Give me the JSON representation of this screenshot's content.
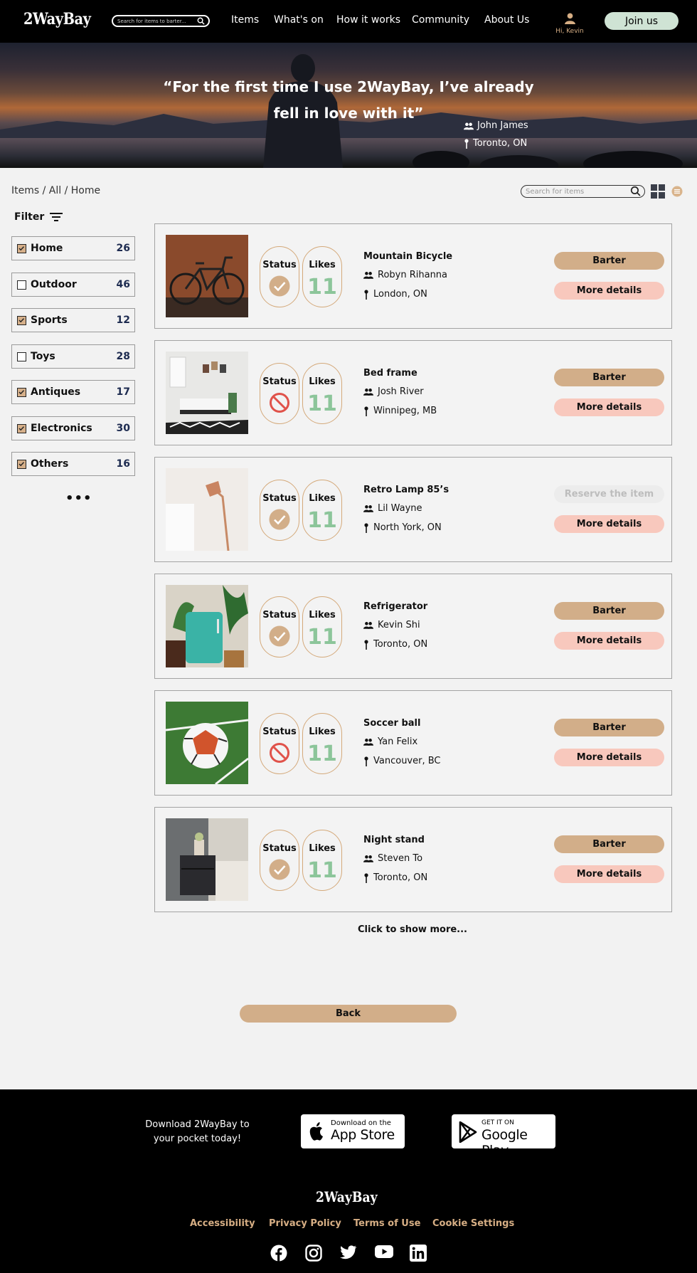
{
  "brand": {
    "logo": "2WayBay"
  },
  "header": {
    "search_placeholder": "Search for items to barter...",
    "nav": [
      "Items",
      "What's on",
      "How it works",
      "Community",
      "About Us"
    ],
    "user_label": "Hi, Kevin",
    "join_label": "Join us"
  },
  "hero": {
    "quote_line1": "“For the first time I use 2WayBay, I’ve already",
    "quote_line2": "fell in love with it”",
    "author": "John James",
    "location": "Toronto, ON"
  },
  "breadcrumb": {
    "items": "Items",
    "all": "All",
    "home": "Home",
    "sep": " / "
  },
  "tools": {
    "search_placeholder": "Search for items"
  },
  "filter": {
    "title": "Filter",
    "categories": [
      {
        "label": "Home",
        "count": "26",
        "checked": true
      },
      {
        "label": "Outdoor",
        "count": "46",
        "checked": false
      },
      {
        "label": "Sports",
        "count": "12",
        "checked": true
      },
      {
        "label": "Toys",
        "count": "28",
        "checked": false
      },
      {
        "label": "Antiques",
        "count": "17",
        "checked": true
      },
      {
        "label": "Electronics",
        "count": "30",
        "checked": true
      },
      {
        "label": "Others",
        "count": "16",
        "checked": true
      }
    ],
    "more": "•••"
  },
  "listing": {
    "status_label": "Status",
    "likes_label": "Likes",
    "barter_label": "Barter",
    "reserve_label": "Reserve the item",
    "details_label": "More details",
    "items": [
      {
        "name": "Mountain Bicycle",
        "owner": "Robyn Rihanna",
        "location": "London, ON",
        "likes": "11",
        "status": "available",
        "action": "barter",
        "photo": "bicycle"
      },
      {
        "name": "Bed frame",
        "owner": "Josh River",
        "location": "Winnipeg, MB",
        "likes": "11",
        "status": "unavailable",
        "action": "barter",
        "photo": "bedroom"
      },
      {
        "name": "Retro Lamp 85’s",
        "owner": "Lil Wayne",
        "location": "North York, ON",
        "likes": "11",
        "status": "available",
        "action": "reserve",
        "photo": "lamp"
      },
      {
        "name": "Refrigerator",
        "owner": "Kevin Shi",
        "location": "Toronto, ON",
        "likes": "11",
        "status": "available",
        "action": "barter",
        "photo": "refrigerator"
      },
      {
        "name": "Soccer ball",
        "owner": "Yan Felix",
        "location": "Vancouver, BC",
        "likes": "11",
        "status": "unavailable",
        "action": "barter",
        "photo": "soccer-ball"
      },
      {
        "name": "Night stand",
        "owner": "Steven To",
        "location": "Toronto, ON",
        "likes": "11",
        "status": "available",
        "action": "barter",
        "photo": "night-stand"
      }
    ],
    "show_more": "Click to show more...",
    "back_label": "Back"
  },
  "footer": {
    "download_text": "Download 2WayBay to your pocket today!",
    "appstore_small": "Download on the",
    "appstore_big": "App Store",
    "googleplay_small": "GET IT ON",
    "googleplay_big": "Google Play",
    "logo": "2WayBay",
    "links": [
      "Accessibility",
      "Privacy Policy",
      "Terms of Use",
      "Cookie Settings"
    ],
    "social": [
      "facebook-icon",
      "instagram-icon",
      "twitter-icon",
      "youtube-icon",
      "linkedin-icon"
    ]
  },
  "colors": {
    "accent_tan": "#d2ae89",
    "pink": "#f8c8bd",
    "mint": "#cfe3d4",
    "likes_green": "#8cc59a",
    "no_red": "#e0524a"
  }
}
